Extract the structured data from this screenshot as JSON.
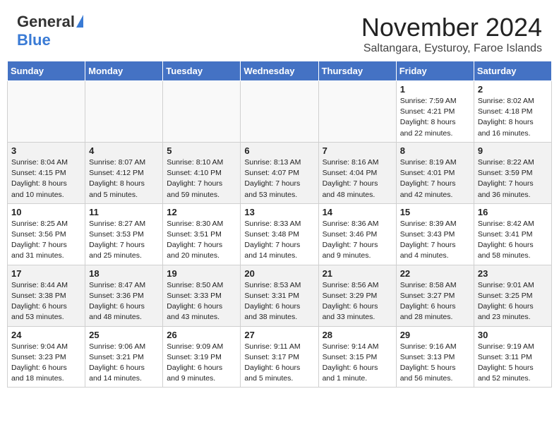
{
  "header": {
    "logo_general": "General",
    "logo_blue": "Blue",
    "main_title": "November 2024",
    "subtitle": "Saltangara, Eysturoy, Faroe Islands"
  },
  "weekdays": [
    "Sunday",
    "Monday",
    "Tuesday",
    "Wednesday",
    "Thursday",
    "Friday",
    "Saturday"
  ],
  "weeks": [
    [
      {
        "day": "",
        "info": ""
      },
      {
        "day": "",
        "info": ""
      },
      {
        "day": "",
        "info": ""
      },
      {
        "day": "",
        "info": ""
      },
      {
        "day": "",
        "info": ""
      },
      {
        "day": "1",
        "info": "Sunrise: 7:59 AM\nSunset: 4:21 PM\nDaylight: 8 hours\nand 22 minutes."
      },
      {
        "day": "2",
        "info": "Sunrise: 8:02 AM\nSunset: 4:18 PM\nDaylight: 8 hours\nand 16 minutes."
      }
    ],
    [
      {
        "day": "3",
        "info": "Sunrise: 8:04 AM\nSunset: 4:15 PM\nDaylight: 8 hours\nand 10 minutes."
      },
      {
        "day": "4",
        "info": "Sunrise: 8:07 AM\nSunset: 4:12 PM\nDaylight: 8 hours\nand 5 minutes."
      },
      {
        "day": "5",
        "info": "Sunrise: 8:10 AM\nSunset: 4:10 PM\nDaylight: 7 hours\nand 59 minutes."
      },
      {
        "day": "6",
        "info": "Sunrise: 8:13 AM\nSunset: 4:07 PM\nDaylight: 7 hours\nand 53 minutes."
      },
      {
        "day": "7",
        "info": "Sunrise: 8:16 AM\nSunset: 4:04 PM\nDaylight: 7 hours\nand 48 minutes."
      },
      {
        "day": "8",
        "info": "Sunrise: 8:19 AM\nSunset: 4:01 PM\nDaylight: 7 hours\nand 42 minutes."
      },
      {
        "day": "9",
        "info": "Sunrise: 8:22 AM\nSunset: 3:59 PM\nDaylight: 7 hours\nand 36 minutes."
      }
    ],
    [
      {
        "day": "10",
        "info": "Sunrise: 8:25 AM\nSunset: 3:56 PM\nDaylight: 7 hours\nand 31 minutes."
      },
      {
        "day": "11",
        "info": "Sunrise: 8:27 AM\nSunset: 3:53 PM\nDaylight: 7 hours\nand 25 minutes."
      },
      {
        "day": "12",
        "info": "Sunrise: 8:30 AM\nSunset: 3:51 PM\nDaylight: 7 hours\nand 20 minutes."
      },
      {
        "day": "13",
        "info": "Sunrise: 8:33 AM\nSunset: 3:48 PM\nDaylight: 7 hours\nand 14 minutes."
      },
      {
        "day": "14",
        "info": "Sunrise: 8:36 AM\nSunset: 3:46 PM\nDaylight: 7 hours\nand 9 minutes."
      },
      {
        "day": "15",
        "info": "Sunrise: 8:39 AM\nSunset: 3:43 PM\nDaylight: 7 hours\nand 4 minutes."
      },
      {
        "day": "16",
        "info": "Sunrise: 8:42 AM\nSunset: 3:41 PM\nDaylight: 6 hours\nand 58 minutes."
      }
    ],
    [
      {
        "day": "17",
        "info": "Sunrise: 8:44 AM\nSunset: 3:38 PM\nDaylight: 6 hours\nand 53 minutes."
      },
      {
        "day": "18",
        "info": "Sunrise: 8:47 AM\nSunset: 3:36 PM\nDaylight: 6 hours\nand 48 minutes."
      },
      {
        "day": "19",
        "info": "Sunrise: 8:50 AM\nSunset: 3:33 PM\nDaylight: 6 hours\nand 43 minutes."
      },
      {
        "day": "20",
        "info": "Sunrise: 8:53 AM\nSunset: 3:31 PM\nDaylight: 6 hours\nand 38 minutes."
      },
      {
        "day": "21",
        "info": "Sunrise: 8:56 AM\nSunset: 3:29 PM\nDaylight: 6 hours\nand 33 minutes."
      },
      {
        "day": "22",
        "info": "Sunrise: 8:58 AM\nSunset: 3:27 PM\nDaylight: 6 hours\nand 28 minutes."
      },
      {
        "day": "23",
        "info": "Sunrise: 9:01 AM\nSunset: 3:25 PM\nDaylight: 6 hours\nand 23 minutes."
      }
    ],
    [
      {
        "day": "24",
        "info": "Sunrise: 9:04 AM\nSunset: 3:23 PM\nDaylight: 6 hours\nand 18 minutes."
      },
      {
        "day": "25",
        "info": "Sunrise: 9:06 AM\nSunset: 3:21 PM\nDaylight: 6 hours\nand 14 minutes."
      },
      {
        "day": "26",
        "info": "Sunrise: 9:09 AM\nSunset: 3:19 PM\nDaylight: 6 hours\nand 9 minutes."
      },
      {
        "day": "27",
        "info": "Sunrise: 9:11 AM\nSunset: 3:17 PM\nDaylight: 6 hours\nand 5 minutes."
      },
      {
        "day": "28",
        "info": "Sunrise: 9:14 AM\nSunset: 3:15 PM\nDaylight: 6 hours\nand 1 minute."
      },
      {
        "day": "29",
        "info": "Sunrise: 9:16 AM\nSunset: 3:13 PM\nDaylight: 5 hours\nand 56 minutes."
      },
      {
        "day": "30",
        "info": "Sunrise: 9:19 AM\nSunset: 3:11 PM\nDaylight: 5 hours\nand 52 minutes."
      }
    ]
  ]
}
